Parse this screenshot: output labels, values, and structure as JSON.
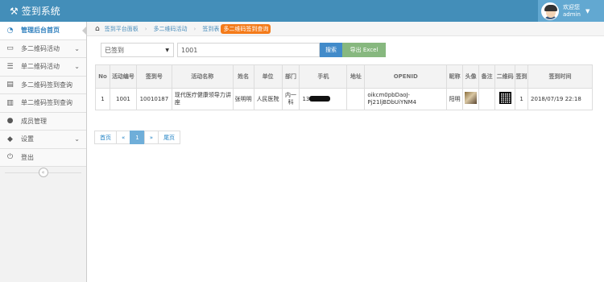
{
  "app": {
    "title": "签到系统"
  },
  "user": {
    "greeting": "欢迎您",
    "name": "admin"
  },
  "sidebar": {
    "items": [
      {
        "label": "管理后台首页",
        "icon": "dashboard-icon",
        "active": true
      },
      {
        "label": "多二维码活动",
        "icon": "desktop-icon",
        "expandable": true
      },
      {
        "label": "单二维码活动",
        "icon": "list-icon",
        "expandable": true
      },
      {
        "label": "多二维码签到查询",
        "icon": "list-alt-icon"
      },
      {
        "label": "单二维码签到查询",
        "icon": "bar-chart-icon"
      },
      {
        "label": "成员管理",
        "icon": "user-icon"
      },
      {
        "label": "设置",
        "icon": "tag-icon",
        "expandable": true
      },
      {
        "label": "登出",
        "icon": "power-icon"
      }
    ]
  },
  "breadcrumbs": {
    "home": "签到平台面板",
    "level2": "多二维码活动",
    "level3": "签到表",
    "current": "多二维码签到查询"
  },
  "filters": {
    "status_value": "已签到",
    "search_value": "1001",
    "search_button": "搜索",
    "export_button": "导出 Excel"
  },
  "table": {
    "headers": [
      "No",
      "活动编号",
      "签到号",
      "活动名称",
      "姓名",
      "单位",
      "部门",
      "手机",
      "地址",
      "OPENID",
      "昵称",
      "头像",
      "备注",
      "二维码",
      "签到",
      "签到时间"
    ],
    "rows": [
      {
        "no": "1",
        "activity_id": "1001",
        "signin_no": "10010187",
        "activity_name": "现代医疗健康领导力讲座",
        "name": "张明明",
        "unit": "人民医院",
        "dept": "内一科",
        "phone": "13",
        "address": "",
        "openid": "oikcm0pbDaoJ-Pj21ljBDbUiYNM4",
        "nickname": "阳明",
        "remark": "",
        "signed": "1",
        "time": "2018/07/19 22:18"
      }
    ]
  },
  "pager": {
    "first": "首页",
    "prev": "«",
    "page": "1",
    "next": "»",
    "last": "尾页"
  },
  "colors": {
    "navbar": "#438eb9",
    "primary": "#428bca",
    "success": "#87b87f",
    "warning": "#f47b1a"
  }
}
